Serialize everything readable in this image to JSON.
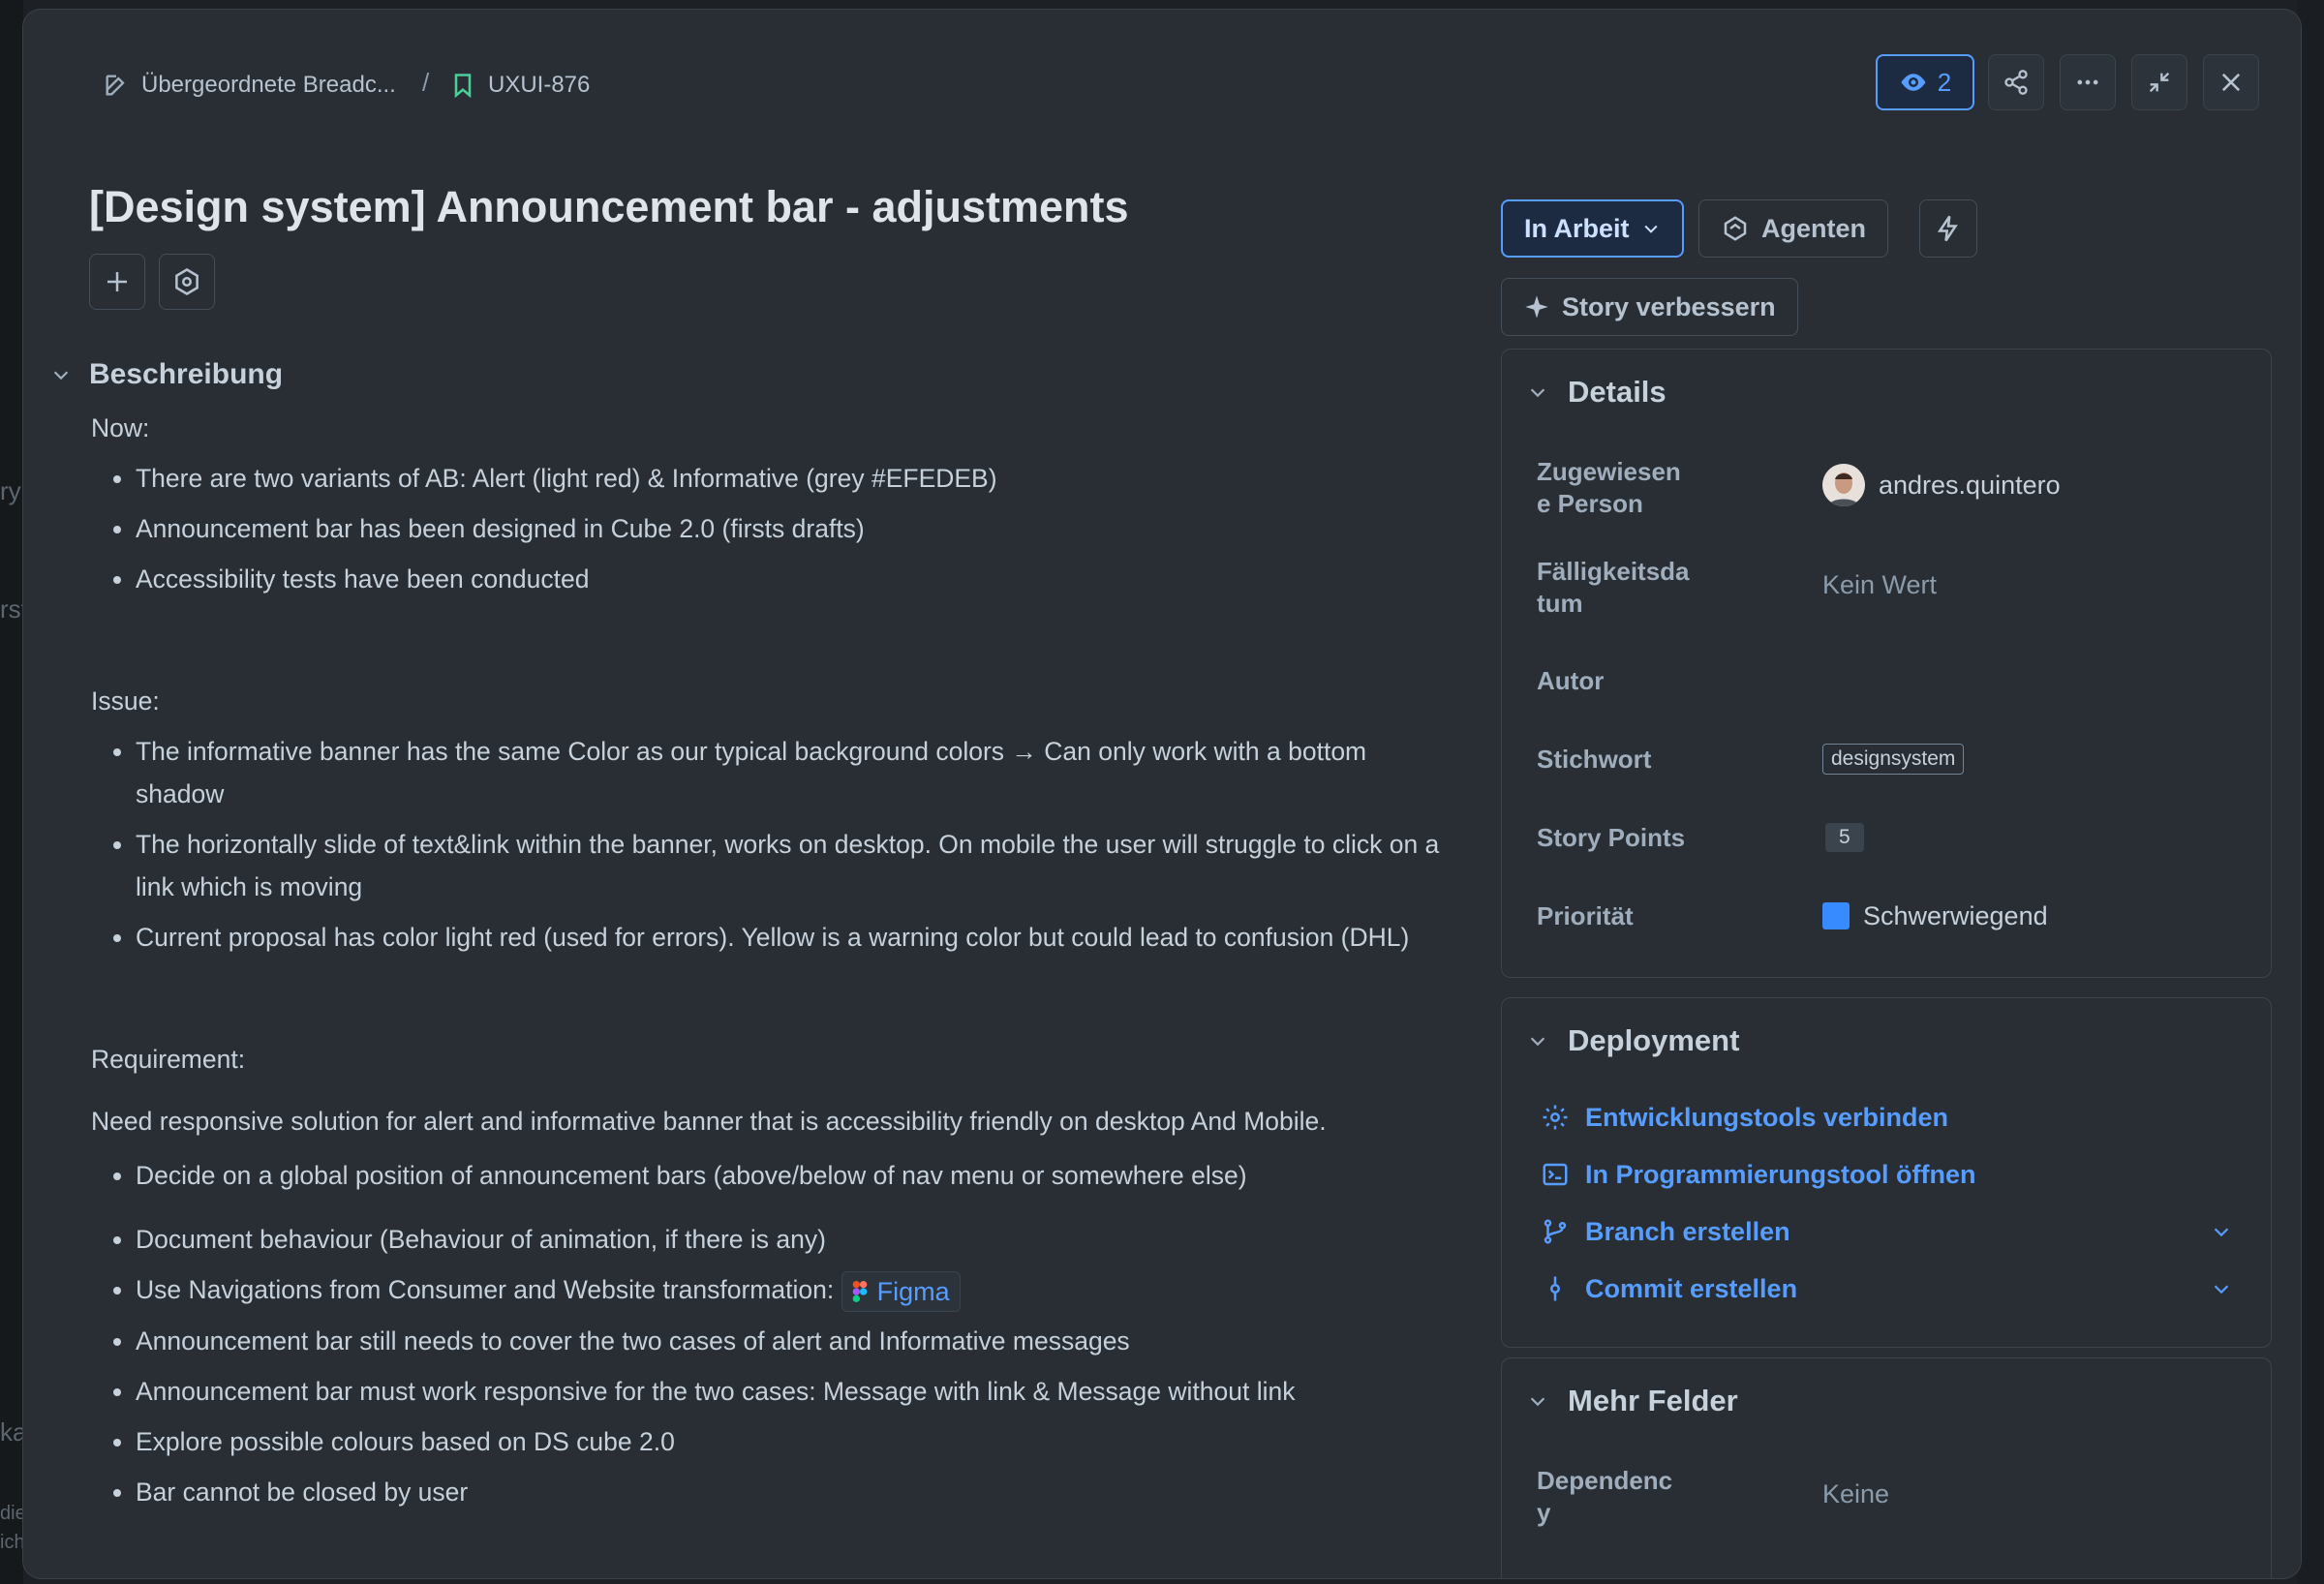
{
  "background": {
    "left_fragments": [
      "ry",
      "rst",
      "ka",
      "die",
      "ich"
    ]
  },
  "breadcrumb": {
    "parent_label": "Übergeordnete Breadc...",
    "separator": "/",
    "issue_key": "UXUI-876"
  },
  "header": {
    "watchers_count": "2",
    "icons": [
      "eye-icon",
      "share-icon",
      "more-icon",
      "minimize-icon",
      "close-icon"
    ]
  },
  "issue": {
    "title": "[Design system] Announcement bar - adjustments"
  },
  "actions": {
    "status_label": "In Arbeit",
    "agents_label": "Agenten",
    "improve_label": "Story verbessern"
  },
  "description": {
    "heading": "Beschreibung",
    "now_label": "Now:",
    "now_items": [
      "There are two variants of AB: Alert (light red) & Informative (grey #EFEDEB)",
      "Announcement bar has been designed in Cube 2.0 (firsts drafts)",
      "Accessibility tests have been conducted"
    ],
    "issue_label": "Issue:",
    "issue_items": [
      "The informative banner has the same Color as our typical background colors → Can only work with a bottom shadow",
      "The horizontally slide of text&link within the banner, works on desktop. On mobile the user will struggle to click on a link which is moving",
      "Current proposal has color light red (used for errors). Yellow is a warning color but could lead to confusion (DHL)"
    ],
    "requirement_label": "Requirement:",
    "requirement_text": "Need responsive solution for alert and informative banner that is accessibility friendly on desktop And Mobile.",
    "req_item_1": "Decide on a global position of announcement bars (above/below of nav menu or somewhere else)",
    "req_item_2": "Document behaviour (Behaviour of animation, if there is any)",
    "req_item_3_text": "Use Navigations from Consumer and Website transformation:",
    "req_item_3_link": "Figma",
    "req_item_4": "Announcement bar still needs to cover the two cases of alert and Informative messages",
    "req_item_5": "Announcement bar must work responsive for the two cases: Message with link & Message without link",
    "req_item_6": "Explore possible colours based on DS cube 2.0",
    "req_item_7": "Bar cannot be closed by user"
  },
  "details": {
    "heading": "Details",
    "assignee_label": "Zugewiesen\ne Person",
    "assignee_value": "andres.quintero",
    "due_label": "Fälligkeitsda\ntum",
    "due_value": "Kein Wert",
    "author_label": "Autor",
    "label_label": "Stichwort",
    "label_value": "designsystem",
    "points_label": "Story Points",
    "points_value": "5",
    "priority_label": "Priorität",
    "priority_value": "Schwerwiegend",
    "priority_color": "#388bff"
  },
  "deployment": {
    "heading": "Deployment",
    "connect_tools": "Entwicklungstools verbinden",
    "open_ide": "In Programmierungstool öffnen",
    "create_branch": "Branch erstellen",
    "create_commit": "Commit erstellen"
  },
  "more_fields": {
    "heading": "Mehr Felder",
    "dependency_label": "Dependenc\ny",
    "dependency_value": "Keine"
  },
  "colors": {
    "accent": "#579dff",
    "modal_bg": "#282e33",
    "page_bg": "#1d2125"
  }
}
